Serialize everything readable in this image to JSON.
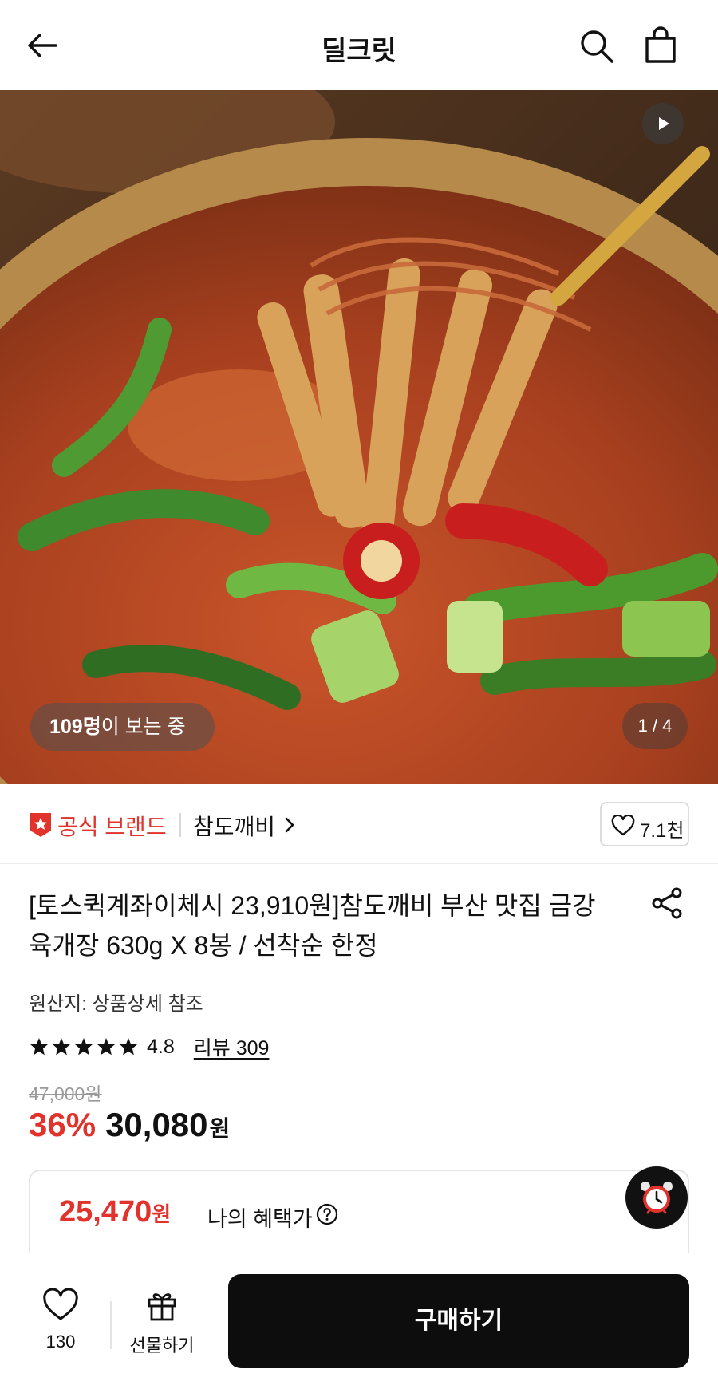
{
  "header": {
    "title": "딜크릿",
    "back_icon": "arrow-left-icon",
    "search_icon": "search-icon",
    "cart_icon": "shopping-bag-icon"
  },
  "hero": {
    "viewers_count": "109명",
    "viewers_suffix": "이 보는 중",
    "pager": "1 / 4",
    "play_icon": "play-icon"
  },
  "brand": {
    "official_label": "공식 브랜드",
    "name": "참도깨비",
    "badge_icon": "official-badge-icon",
    "chevron_icon": "chevron-right-icon",
    "like_count": "7.1천"
  },
  "product": {
    "title": "[토스퀵계좌이체시 23,910원]참도깨비 부산 맛집 금강 육개장 630g X 8봉 / 선착순 한정",
    "origin": "원산지: 상품상세 참조",
    "rating": {
      "stars": 5,
      "score": "4.8",
      "reviews_label": "리뷰 309"
    },
    "original_price": "47,000원",
    "discount": "36%",
    "price": "30,080",
    "currency": "원",
    "benefit": {
      "price": "25,470",
      "currency": "원",
      "label": "나의 혜택가"
    }
  },
  "bottom_bar": {
    "favorite_count": "130",
    "gift_label": "선물하기",
    "buy_label": "구매하기"
  },
  "colors": {
    "accent_red": "#e1322b",
    "buy_button": "#0d0d0d"
  }
}
